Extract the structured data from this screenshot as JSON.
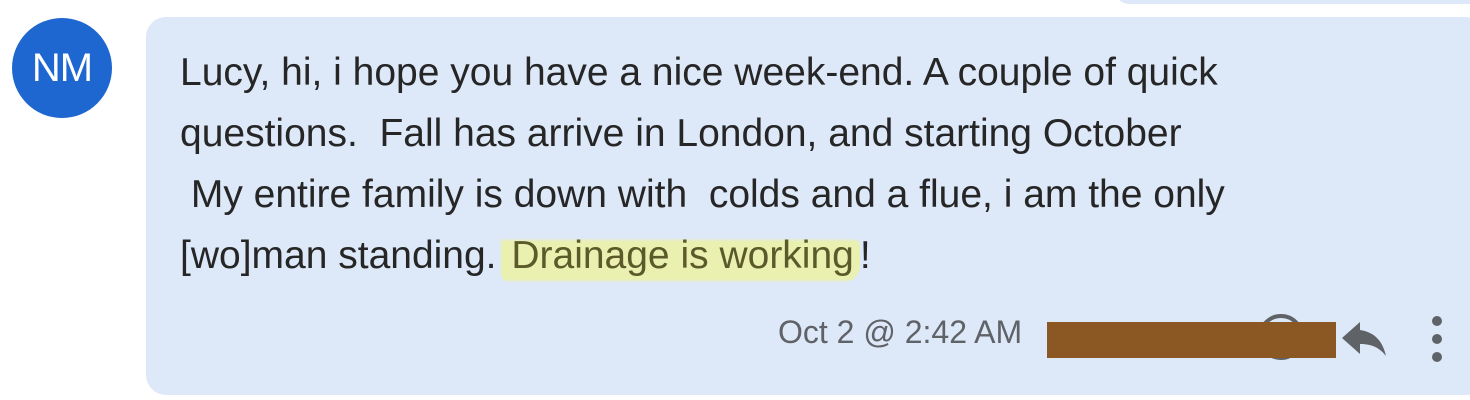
{
  "sender": {
    "initials": "NM",
    "avatar_color": "#1f67d0"
  },
  "message": {
    "text_before": "Lucy, hi, i hope you have a nice week-end. A couple of quick\nquestions.  Fall has arrive in London, and starting October\n My entire family is down with  colds and a flue, i am the only\n[wo]man standing.",
    "highlighted": "Drainage is working",
    "text_after": "!",
    "highlight_color": "#eaf0b0",
    "bubble_color": "#dde8f8"
  },
  "meta": {
    "timestamp": "Oct 2 @ 2:42 AM"
  },
  "icons": {
    "status": "circle-icon",
    "reply": "reply-icon",
    "more": "more-vert-icon"
  },
  "redaction_color": "#8b5722"
}
